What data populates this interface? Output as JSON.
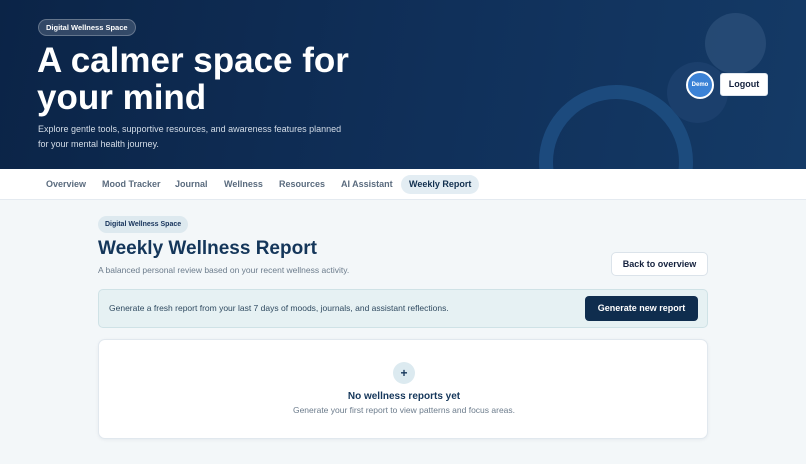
{
  "hero": {
    "badge": "Digital Wellness Space",
    "title": "A calmer space for your mind",
    "subtitle": "Explore gentle tools, supportive resources, and awareness features planned for your mental health journey."
  },
  "user": {
    "avatar_label": "Demo",
    "logout_label": "Logout"
  },
  "nav": {
    "items": [
      {
        "label": "Overview"
      },
      {
        "label": "Mood Tracker"
      },
      {
        "label": "Journal"
      },
      {
        "label": "Wellness"
      },
      {
        "label": "Resources"
      },
      {
        "label": "AI Assistant"
      },
      {
        "label": "Weekly Report"
      }
    ],
    "active": "Weekly Report"
  },
  "report": {
    "chip": "Digital Wellness Space",
    "title": "Weekly Wellness Report",
    "subtitle": "A balanced personal review based on your recent wellness activity.",
    "back_label": "Back to overview",
    "generate_text": "Generate a fresh report from your last 7 days of moods, journals, and assistant reflections.",
    "generate_label": "Generate new report",
    "empty_icon": "+",
    "empty_title": "No wellness reports yet",
    "empty_subtitle": "Generate your first report to view patterns and focus areas."
  },
  "colors": {
    "hero_bg": "#0b2447",
    "primary": "#0f2d4e",
    "accent": "#3b82d6",
    "page_bg": "#f3f7f9"
  }
}
